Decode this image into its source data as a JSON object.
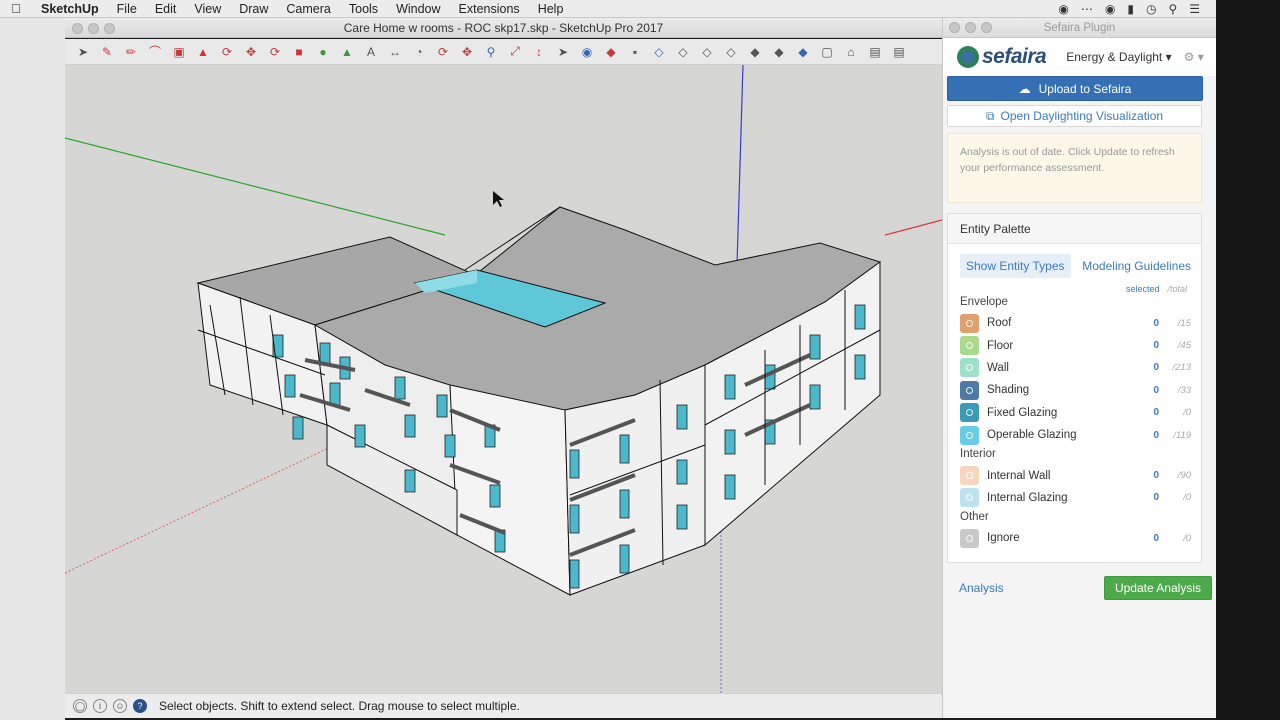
{
  "menubar": {
    "app_name": "SketchUp",
    "items": [
      "File",
      "Edit",
      "View",
      "Draw",
      "Camera",
      "Tools",
      "Window",
      "Extensions",
      "Help"
    ]
  },
  "window": {
    "title": "Care Home w rooms - ROC skp17.skp - SketchUp Pro 2017"
  },
  "toolbar": {
    "tools": [
      "select-tool",
      "eraser-tool",
      "pencil-tool",
      "arc-tool",
      "rectangle-tool",
      "push-pull-tool",
      "offset-tool",
      "move-tool",
      "rotate-tool",
      "scale-tool",
      "tape-measure-tool",
      "paint-bucket-tool",
      "text-tool",
      "dimension-tool",
      "protractor-tool",
      "orbit-tool",
      "pan-tool",
      "zoom-tool",
      "zoom-extents-tool",
      "walk-tool",
      "position-camera-tool",
      "look-around-tool",
      "section-plane-tool",
      "xray-tool",
      "back-edges-tool",
      "wireframe-tool",
      "hidden-line-tool",
      "shaded-tool",
      "shaded-textures-tool",
      "monochrome-tool",
      "iso-view",
      "top-view",
      "front-view",
      "right-view",
      "back-view",
      "left-view"
    ]
  },
  "statusbar": {
    "text": "Select objects. Shift to extend select. Drag mouse to select multiple."
  },
  "plugin": {
    "window_title": "Sefaira Plugin",
    "logo_text": "sefaira",
    "mode": "Energy & Daylight",
    "upload_label": "Upload to Sefaira",
    "open_label": "Open Daylighting Visualization",
    "notice": "Analysis is out of date. Click Update to refresh your performance assessment.",
    "palette_title": "Entity Palette",
    "tab_entity_types": "Show Entity Types",
    "tab_modeling": "Modeling Guidelines",
    "col_selected": "selected",
    "col_total": "/total",
    "groups": [
      {
        "name": "Envelope",
        "rows": [
          {
            "label": "Roof",
            "sel": "0",
            "tot": "/15",
            "color": "#e0a06e"
          },
          {
            "label": "Floor",
            "sel": "0",
            "tot": "/45",
            "color": "#a9d98a"
          },
          {
            "label": "Wall",
            "sel": "0",
            "tot": "/213",
            "color": "#9be0c7"
          },
          {
            "label": "Shading",
            "sel": "0",
            "tot": "/33",
            "color": "#4f7aa3"
          },
          {
            "label": "Fixed Glazing",
            "sel": "0",
            "tot": "/0",
            "color": "#3a9ab8"
          },
          {
            "label": "Operable Glazing",
            "sel": "0",
            "tot": "/119",
            "color": "#67cde6"
          }
        ]
      },
      {
        "name": "Interior",
        "rows": [
          {
            "label": "Internal Wall",
            "sel": "0",
            "tot": "/90",
            "color": "#f6d6bf"
          },
          {
            "label": "Internal Glazing",
            "sel": "0",
            "tot": "/0",
            "color": "#bfe3ee"
          }
        ]
      },
      {
        "name": "Other",
        "rows": [
          {
            "label": "Ignore",
            "sel": "0",
            "tot": "/0",
            "color": "#c8c8c8"
          }
        ]
      }
    ],
    "analysis_label": "Analysis",
    "update_label": "Update Analysis"
  }
}
